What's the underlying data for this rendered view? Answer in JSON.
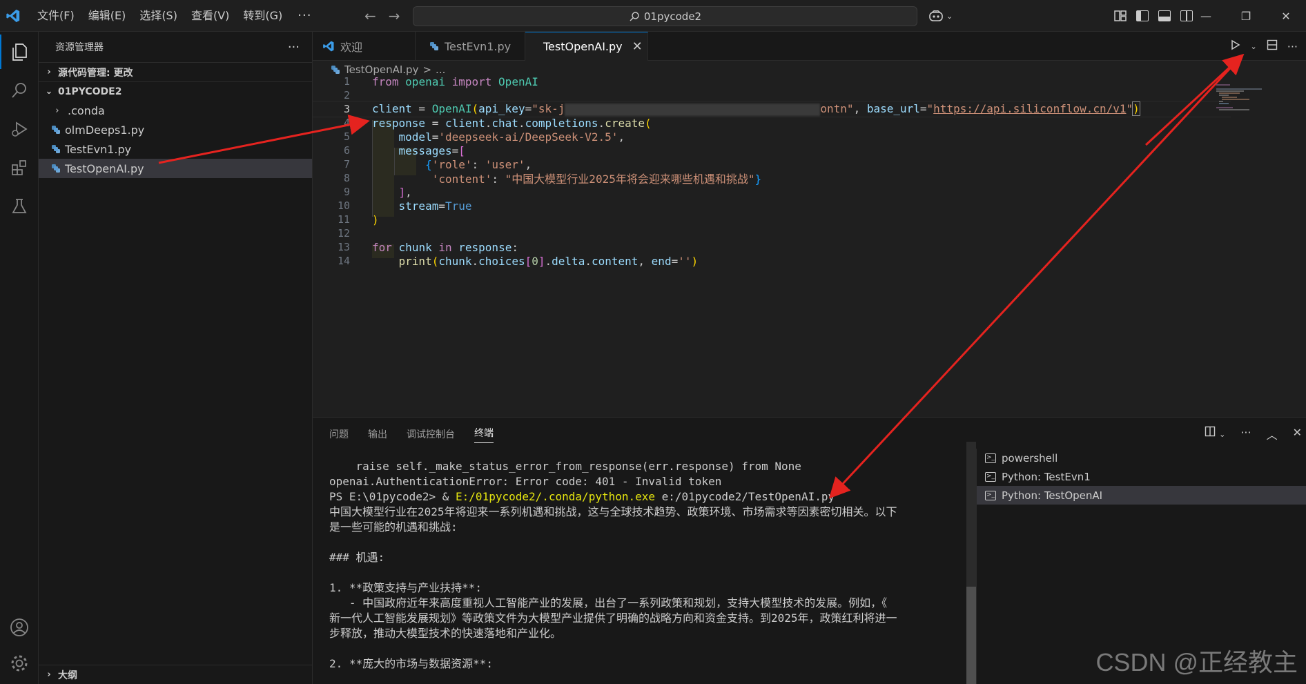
{
  "menu": {
    "items": [
      "文件(F)",
      "编辑(E)",
      "选择(S)",
      "查看(V)",
      "转到(G)"
    ],
    "more": "···"
  },
  "command_center": {
    "text": "01pycode2"
  },
  "sidebar": {
    "title": "资源管理器",
    "more": "···",
    "scm_section": "源代码管理: 更改",
    "folder": "01PYCODE2",
    "items": [
      {
        "label": ".conda",
        "type": "folder"
      },
      {
        "label": "olmDeeps1.py",
        "type": "file"
      },
      {
        "label": "TestEvn1.py",
        "type": "file"
      },
      {
        "label": "TestOpenAI.py",
        "type": "file",
        "selected": true
      }
    ],
    "outline": "大纲"
  },
  "tabs": [
    {
      "label": "欢迎",
      "active": false
    },
    {
      "label": "TestEvn1.py",
      "active": false
    },
    {
      "label": "TestOpenAI.py",
      "active": true
    }
  ],
  "breadcrumb": {
    "file": "TestOpenAI.py",
    "sep": ">",
    "rest": "..."
  },
  "editor": {
    "line_numbers": [
      "1",
      "2",
      "3",
      "4",
      "5",
      "6",
      "7",
      "8",
      "9",
      "10",
      "11",
      "12",
      "13",
      "14"
    ],
    "current_line": 3,
    "code": {
      "l1_from": "from",
      "l1_mod": "openai",
      "l1_import": "import",
      "l1_cls": "OpenAI",
      "l3_var": "client",
      "l3_eq": " = ",
      "l3_fn": "OpenAI",
      "l3_p1": "(",
      "l3_arg1": "api_key",
      "l3_eq2": "=",
      "l3_str1a": "\"sk-j",
      "l3_str1b": "ontn\"",
      "l3_comma": ", ",
      "l3_arg2": "base_url",
      "l3_eq3": "=",
      "l3_q1": "\"",
      "l3_url": "https://api.siliconflow.cn/v1",
      "l3_q2": "\"",
      "l3_p2": ")",
      "l4_var": "response",
      "l4_eq": " = ",
      "l4_obj": "client",
      "l4_dot1": ".",
      "l4_chat": "chat",
      "l4_dot2": ".",
      "l4_comp": "completions",
      "l4_dot3": ".",
      "l4_fn": "create",
      "l4_p": "(",
      "l5_arg": "model",
      "l5_eq": "=",
      "l5_str": "'deepseek-ai/DeepSeek-V2.5'",
      "l5_comma": ",",
      "l6_arg": "messages",
      "l6_eq": "=",
      "l6_br": "[",
      "l7_br": "{",
      "l7_k": "'role'",
      "l7_colon": ": ",
      "l7_v": "'user'",
      "l7_comma": ",",
      "l8_k": "'content'",
      "l8_colon": ": ",
      "l8_v": "\"中国大模型行业2025年将会迎来哪些机遇和挑战\"",
      "l8_br": "}",
      "l9_br": "]",
      "l9_comma": ",",
      "l10_arg": "stream",
      "l10_eq": "=",
      "l10_val": "True",
      "l11_p": ")",
      "l13_for": "for",
      "l13_var": "chunk",
      "l13_in": "in",
      "l13_obj": "response",
      "l13_colon": ":",
      "l14_fn": "print",
      "l14_p1": "(",
      "l14_obj": "chunk",
      "l14_dot1": ".",
      "l14_attr1": "choices",
      "l14_b1": "[",
      "l14_num": "0",
      "l14_b2": "]",
      "l14_dot2": ".",
      "l14_attr2": "delta",
      "l14_dot3": ".",
      "l14_attr3": "content",
      "l14_comma": ", ",
      "l14_arg": "end",
      "l14_eq": "=",
      "l14_str": "''",
      "l14_p2": ")"
    }
  },
  "panel": {
    "tabs": [
      "问题",
      "输出",
      "调试控制台",
      "终端"
    ],
    "active_tab": "终端",
    "terminal_lines": [
      "    raise self._make_status_error_from_response(err.response) from None",
      "openai.AuthenticationError: Error code: 401 - Invalid token",
      "中国大模型行业在2025年将迎来一系列机遇和挑战，这与全球技术趋势、政策环境、市场需求等因素密切相关。以下",
      "是一些可能的机遇和挑战:",
      "",
      "### 机遇:",
      "",
      "1. **政策支持与产业扶持**:",
      "   - 中国政府近年来高度重视人工智能产业的发展，出台了一系列政策和规划，支持大模型技术的发展。例如，《",
      "新一代人工智能发展规划》等政策文件为大模型产业提供了明确的战略方向和资金支持。到2025年，政策红利将进一",
      "步释放，推动大模型技术的快速落地和产业化。",
      "",
      "2. **庞大的市场与数据资源**:"
    ],
    "prompt": "PS E:\\01pycode2> & ",
    "prompt_exe": "E:/01pycode2/.conda/python.exe",
    "prompt_arg": " e:/01pycode2/TestOpenAI.py",
    "terminals": [
      {
        "label": "powershell",
        "selected": false
      },
      {
        "label": "Python: TestEvn1",
        "selected": false
      },
      {
        "label": "Python: TestOpenAI",
        "selected": true
      }
    ]
  },
  "watermark": "CSDN @正经教主",
  "colors": {
    "accent": "#0078d4",
    "annotation_arrow": "#e5231f"
  }
}
